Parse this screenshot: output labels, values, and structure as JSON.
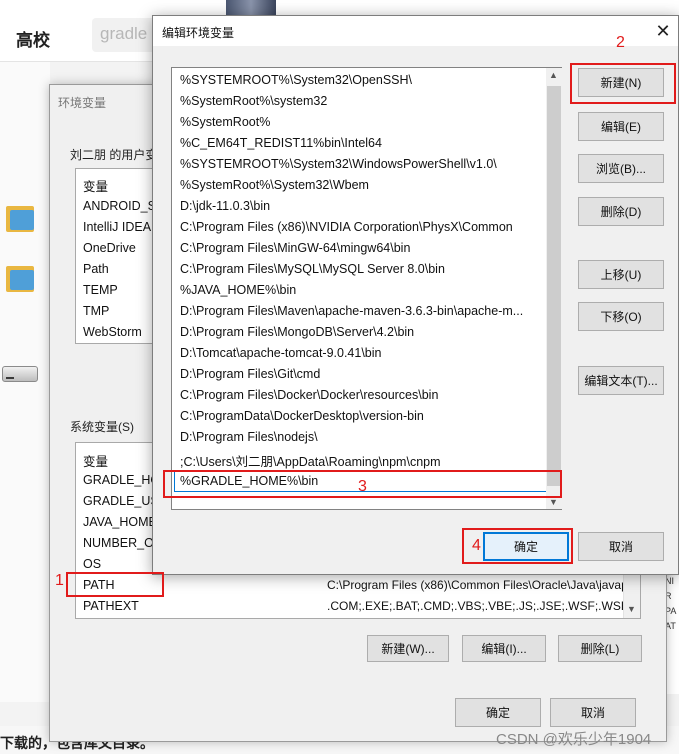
{
  "background": {
    "brand": "高校",
    "search_text": "gradle",
    "bottom_text": "下载的，包含库文目录。"
  },
  "env_dialog": {
    "title": "环境变量",
    "user_section_label": "刘二朋 的用户变",
    "user_header": "变量",
    "user_vars": [
      "ANDROID_S",
      "IntelliJ IDEA",
      "OneDrive",
      "Path",
      "TEMP",
      "TMP",
      "WebStorm"
    ],
    "sys_section_label": "系统变量(S)",
    "sys_header": "变量",
    "sys_vars": [
      {
        "name": "GRADLE_HO",
        "value": ""
      },
      {
        "name": "GRADLE_US",
        "value": ""
      },
      {
        "name": "JAVA_HOME",
        "value": ""
      },
      {
        "name": "NUMBER_O",
        "value": ""
      },
      {
        "name": "OS",
        "value": ""
      },
      {
        "name": "PATH",
        "value": "C:\\Program Files (x86)\\Common Files\\Oracle\\Java\\javapath;C:..."
      },
      {
        "name": "PATHEXT",
        "value": ".COM;.EXE;.BAT;.CMD;.VBS;.VBE;.JS;.JSE;.WSF;.WSH;.MSC"
      }
    ],
    "sys_buttons": {
      "new": "新建(W)...",
      "edit": "编辑(I)...",
      "delete": "删除(L)"
    },
    "ok": "确定",
    "cancel": "取消"
  },
  "edit_dialog": {
    "title": "编辑环境变量",
    "close": "✕",
    "paths": [
      "%SYSTEMROOT%\\System32\\OpenSSH\\",
      "%SystemRoot%\\system32",
      "%SystemRoot%",
      "%C_EM64T_REDIST11%bin\\Intel64",
      "%SYSTEMROOT%\\System32\\WindowsPowerShell\\v1.0\\",
      "%SystemRoot%\\System32\\Wbem",
      "D:\\jdk-11.0.3\\bin",
      "C:\\Program Files (x86)\\NVIDIA Corporation\\PhysX\\Common",
      "C:\\Program Files\\MinGW-64\\mingw64\\bin",
      "C:\\Program Files\\MySQL\\MySQL Server 8.0\\bin",
      "%JAVA_HOME%\\bin",
      "D:\\Program Files\\Maven\\apache-maven-3.6.3-bin\\apache-m...",
      "D:\\Program Files\\MongoDB\\Server\\4.2\\bin",
      "D:\\Tomcat\\apache-tomcat-9.0.41\\bin",
      "D:\\Program Files\\Git\\cmd",
      "C:\\Program Files\\Docker\\Docker\\resources\\bin",
      "C:\\ProgramData\\DockerDesktop\\version-bin",
      "D:\\Program Files\\nodejs\\",
      ";C:\\Users\\刘二朋\\AppData\\Roaming\\npm\\cnpm"
    ],
    "editing_value": "%GRADLE_HOME%\\bin",
    "buttons": {
      "new": "新建(N)",
      "edit": "编辑(E)",
      "browse": "浏览(B)...",
      "delete": "删除(D)",
      "move_up": "上移(U)",
      "move_down": "下移(O)",
      "edit_text": "编辑文本(T)..."
    },
    "ok": "确定",
    "cancel": "取消"
  },
  "annotations": [
    "1",
    "2",
    "3",
    "4"
  ],
  "watermark": "CSDN @欢乐少年1904",
  "colors": {
    "annotation": "#e11b1b",
    "focus": "#0078d7"
  }
}
